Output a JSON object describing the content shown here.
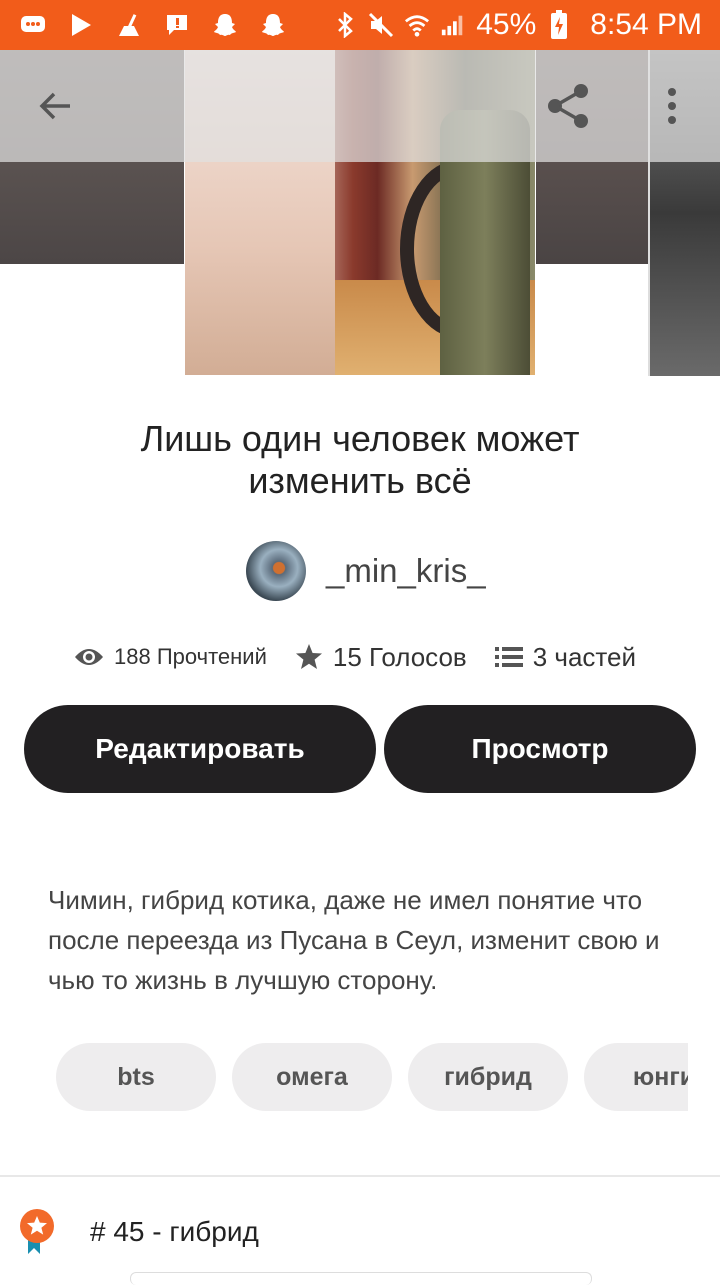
{
  "status_bar": {
    "battery": "45%",
    "time": "8:54 PM",
    "icons": [
      "messages-icon",
      "play-store-icon",
      "cleaner-icon",
      "alert-icon",
      "snapchat-icon",
      "snapchat-icon",
      "bluetooth-icon",
      "mute-icon",
      "wifi-icon",
      "signal-icon",
      "battery-charging-icon"
    ]
  },
  "colors": {
    "status_bar": "#f25c1a",
    "button_bg": "#222022",
    "tag_bg": "#eeedee",
    "rank_badge": "#f26a2a",
    "rank_ribbon": "#1a8fb0"
  },
  "story": {
    "title": "Лишь один человек может изменить всё",
    "author": "_min_kris_",
    "stats": {
      "reads": "188 Прочтений",
      "votes": "15 Голосов",
      "parts": "3 частей"
    },
    "buttons": {
      "edit": "Редактировать",
      "view": "Просмотр"
    },
    "description": "Чимин, гибрид котика, даже не имел понятие что после переезда из Пусана в Сеул, изменит свою и чью то жизнь в лучшую сторону.",
    "tags": [
      "bts",
      "омега",
      "гибрид",
      "юнги"
    ],
    "rank": "# 45 - гибрид"
  }
}
